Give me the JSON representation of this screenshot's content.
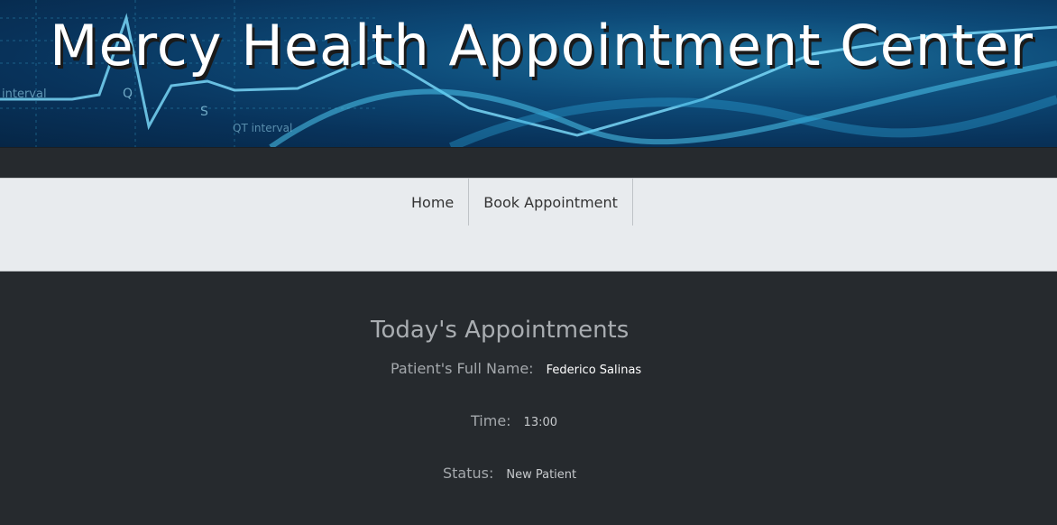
{
  "header": {
    "title": "Mercy Health Appointment Center",
    "banner_text": [
      "interval",
      "Q",
      "S",
      "QT interval"
    ]
  },
  "nav": {
    "items": [
      {
        "label": "Home"
      },
      {
        "label": "Book Appointment"
      }
    ]
  },
  "appointments": {
    "title": "Today's Appointments",
    "fields": {
      "name_label": "Patient's Full Name:",
      "name_value": "Federico Salinas",
      "time_label": "Time:",
      "time_value": "13:00",
      "status_label": "Status:",
      "status_value": "New Patient"
    }
  },
  "colors": {
    "banner_blue": "#0d4a78",
    "page_dark": "#262a2e",
    "navbar_bg": "#e8ebee",
    "heading_gray": "#a9adb1"
  }
}
